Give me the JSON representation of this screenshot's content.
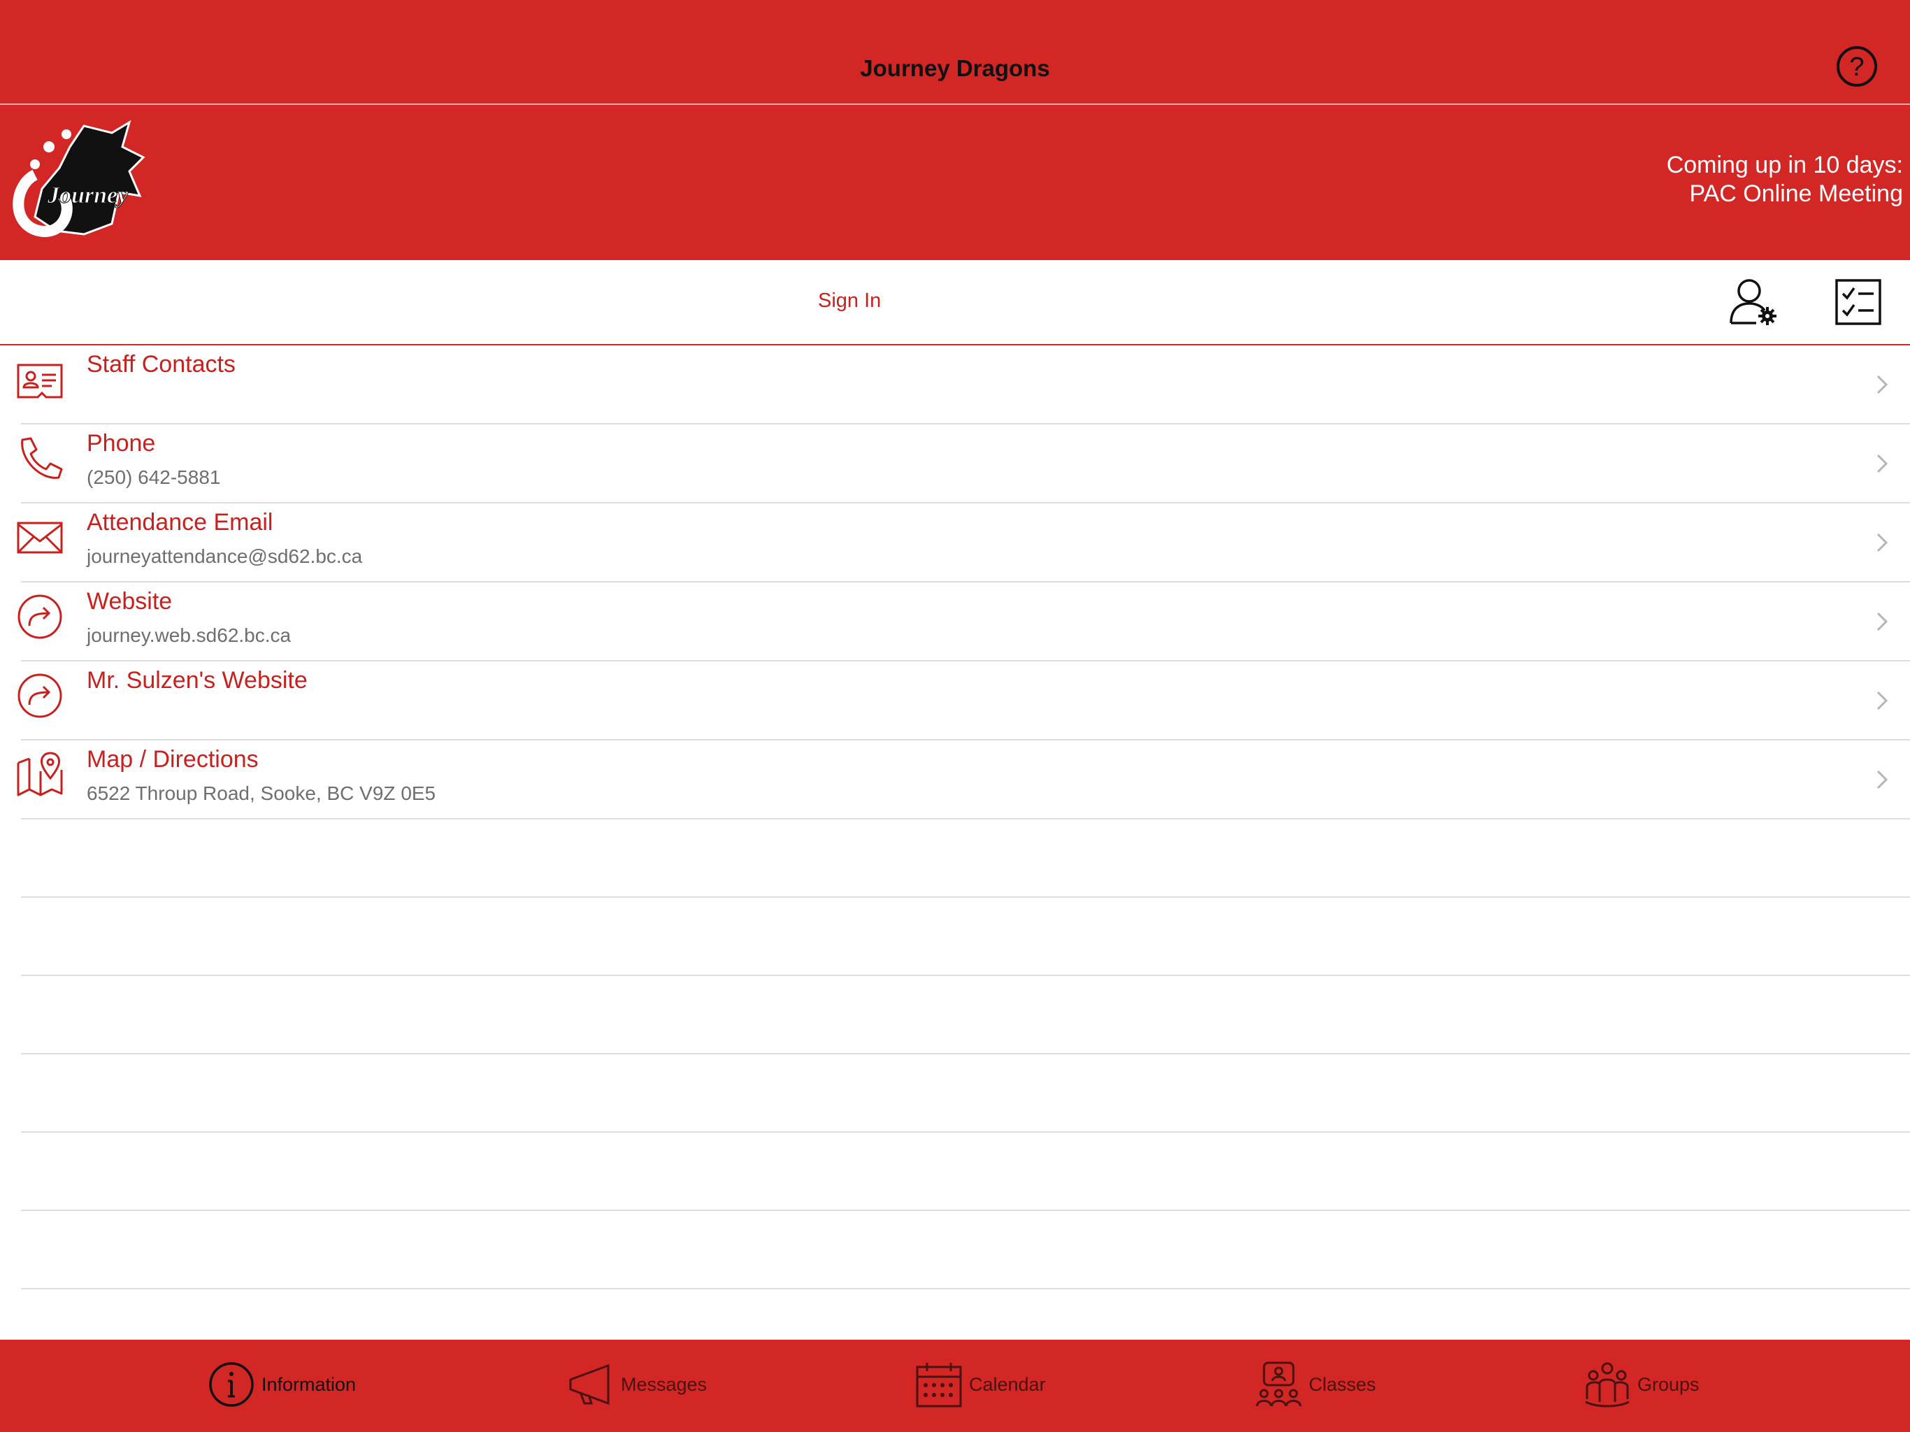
{
  "header": {
    "title": "Journey Dragons",
    "help_icon": "question-circle-icon"
  },
  "banner": {
    "logo_text": "Journey",
    "upcoming_line1": "Coming up in 10 days:",
    "upcoming_line2": "PAC Online Meeting"
  },
  "toolbar": {
    "sign_in_label": "Sign In"
  },
  "list": {
    "items": [
      {
        "title": "Staff Contacts",
        "subtitle": "",
        "icon": "contact-card-icon"
      },
      {
        "title": "Phone",
        "subtitle": "(250) 642-5881",
        "icon": "phone-icon"
      },
      {
        "title": "Attendance Email",
        "subtitle": "journeyattendance@sd62.bc.ca",
        "icon": "mail-icon"
      },
      {
        "title": "Website",
        "subtitle": "journey.web.sd62.bc.ca",
        "icon": "share-arrow-icon"
      },
      {
        "title": "Mr. Sulzen's Website",
        "subtitle": "",
        "icon": "share-arrow-icon"
      },
      {
        "title": "Map / Directions",
        "subtitle": "6522 Throup Road, Sooke, BC V9Z 0E5",
        "icon": "map-pin-icon"
      }
    ]
  },
  "tabs": [
    {
      "label": "Information",
      "icon": "info-icon",
      "active": true
    },
    {
      "label": "Messages",
      "icon": "megaphone-icon",
      "active": false
    },
    {
      "label": "Calendar",
      "icon": "calendar-icon",
      "active": false
    },
    {
      "label": "Classes",
      "icon": "classes-icon",
      "active": false
    },
    {
      "label": "Groups",
      "icon": "groups-icon",
      "active": false
    }
  ],
  "colors": {
    "brand_red": "#d22724",
    "text_red": "#c8211d",
    "subtitle_gray": "#6e6e6e"
  }
}
